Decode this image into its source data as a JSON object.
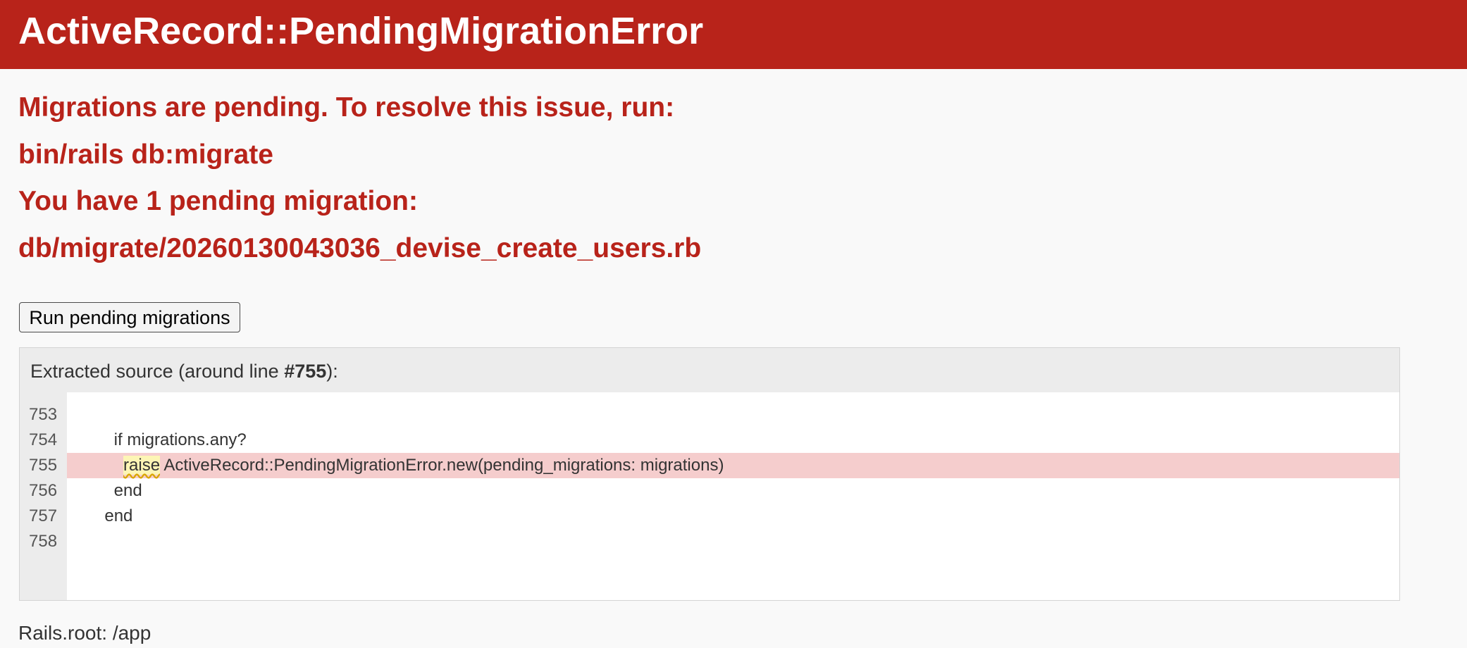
{
  "header": {
    "title": "ActiveRecord::PendingMigrationError"
  },
  "messages": [
    "Migrations are pending. To resolve this issue, run:",
    "bin/rails db:migrate",
    "You have 1 pending migration:",
    "db/migrate/20260130043036_devise_create_users.rb"
  ],
  "run_button": {
    "label": "Run pending migrations"
  },
  "source": {
    "title_prefix": "Extracted source (around line ",
    "title_line": "#755",
    "title_suffix": "):",
    "line_numbers": [
      "753",
      "754",
      "755",
      "756",
      "757",
      "758"
    ],
    "lines": [
      "",
      "          if migrations.any?",
      "            ",
      "          end",
      "        end",
      ""
    ],
    "highlighted_keyword": "raise",
    "highlighted_rest": " ActiveRecord::PendingMigrationError.new(pending_migrations: migrations)"
  },
  "footer": {
    "rails_root": "Rails.root: /app"
  },
  "colors": {
    "accent": "#b8231a",
    "highlight_line": "#f5cdcd",
    "keyword_highlight": "#fdf5b5"
  }
}
